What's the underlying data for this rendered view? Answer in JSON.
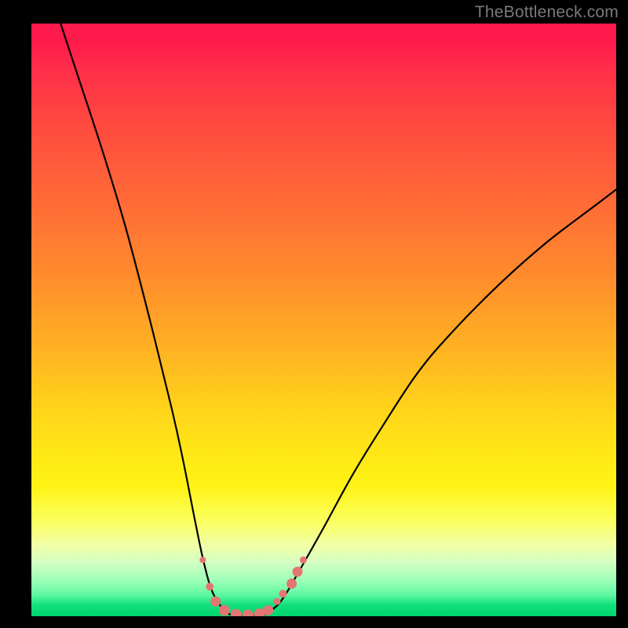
{
  "watermark": "TheBottleneck.com",
  "colors": {
    "background": "#000000",
    "curve": "#000000",
    "markers": "#e37573",
    "gradient_top": "#ff1a4c",
    "gradient_bottom": "#00d46e"
  },
  "chart_data": {
    "type": "line",
    "title": "",
    "xlabel": "",
    "ylabel": "",
    "xlim": [
      0,
      100
    ],
    "ylim": [
      0,
      100
    ],
    "grid": false,
    "series": [
      {
        "name": "bottleneck-curve",
        "x": [
          5,
          8,
          12,
          16,
          20,
          24,
          26,
          28,
          29.5,
          31,
          33,
          35,
          37,
          39,
          41,
          43,
          46,
          50,
          55,
          60,
          66,
          72,
          80,
          88,
          96,
          100
        ],
        "y": [
          100,
          91,
          79,
          66,
          51,
          35,
          26,
          16,
          9,
          4,
          1,
          0,
          0,
          0,
          1,
          3,
          8,
          15,
          24,
          32,
          41,
          48,
          56,
          63,
          69,
          72
        ]
      }
    ],
    "markers": {
      "name": "highlighted-points",
      "points": [
        {
          "x": 29.3,
          "y": 9.5
        },
        {
          "x": 30.5,
          "y": 5.0
        },
        {
          "x": 31.5,
          "y": 2.5
        },
        {
          "x": 33.0,
          "y": 1.0
        },
        {
          "x": 35.0,
          "y": 0.3
        },
        {
          "x": 37.0,
          "y": 0.2
        },
        {
          "x": 39.0,
          "y": 0.4
        },
        {
          "x": 40.5,
          "y": 1.0
        },
        {
          "x": 42.0,
          "y": 2.5
        },
        {
          "x": 43.0,
          "y": 3.8
        },
        {
          "x": 44.5,
          "y": 5.5
        },
        {
          "x": 45.5,
          "y": 7.5
        },
        {
          "x": 46.5,
          "y": 9.5
        }
      ],
      "sizes": [
        8,
        10,
        13,
        14,
        14,
        14,
        14,
        13,
        9,
        10,
        13,
        13,
        9
      ]
    }
  }
}
